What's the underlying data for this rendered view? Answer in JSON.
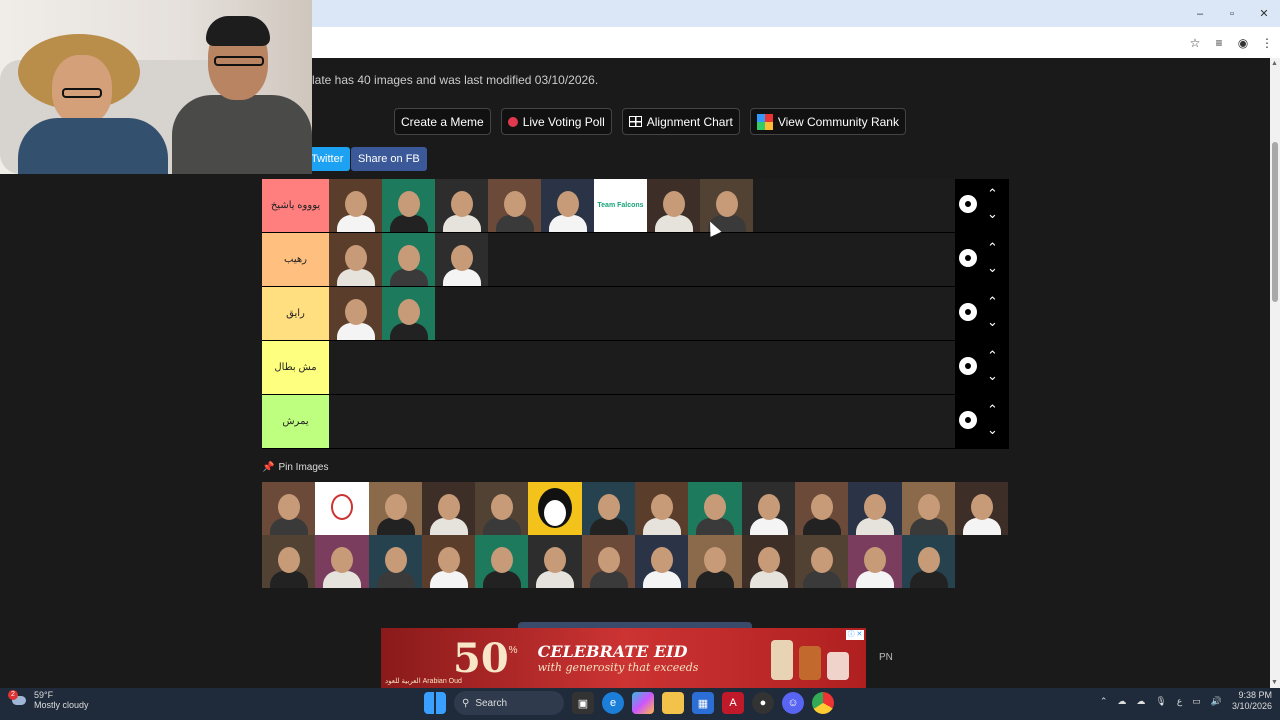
{
  "window": {
    "controls": {
      "minimize": "–",
      "maximize": "▫",
      "close": "✕"
    }
  },
  "address_bar": {
    "icons": [
      "star-icon",
      "media-icon",
      "profile-icon",
      "menu-icon"
    ]
  },
  "info": {
    "modified_text": "late has 40 images and was last modified 03/10/2026."
  },
  "actions": {
    "create_meme": "Create a Meme",
    "live_voting": "Live Voting Poll",
    "alignment": "Alignment Chart",
    "community_rank": "View Community Rank"
  },
  "share": {
    "twitter": "Twitter",
    "facebook": "Share on FB"
  },
  "tiers": [
    {
      "label": "يوووه ياشيخ",
      "color": "#ff7f7f",
      "count": 8
    },
    {
      "label": "رهيب",
      "color": "#ffbf7f",
      "count": 3
    },
    {
      "label": "رايق",
      "color": "#ffdf80",
      "count": 2
    },
    {
      "label": "مش بطال",
      "color": "#ffff7f",
      "count": 0
    },
    {
      "label": "يمرش",
      "color": "#bfff7f",
      "count": 0
    }
  ],
  "tier_items": {
    "team_logo_text": "Team Falcons"
  },
  "pin": {
    "label": "Pin Images"
  },
  "pool": {
    "count": 27,
    "special": {
      "penguin_index": 5,
      "white_logo_index": 1
    }
  },
  "ad": {
    "percent": "50",
    "percent_sign": "%",
    "headline": "CELEBRATE EID",
    "subline": "with generosity that exceeds",
    "brand": "العربية للعود Arabian Oud",
    "adchoice": "ⓘ ✕"
  },
  "pn": "PN",
  "taskbar": {
    "weather_badge": "2",
    "temperature": "59°F",
    "condition": "Mostly cloudy",
    "search_label": "Search",
    "time": "9:38 PM",
    "date": "3/10/2026",
    "lang": "ع"
  }
}
